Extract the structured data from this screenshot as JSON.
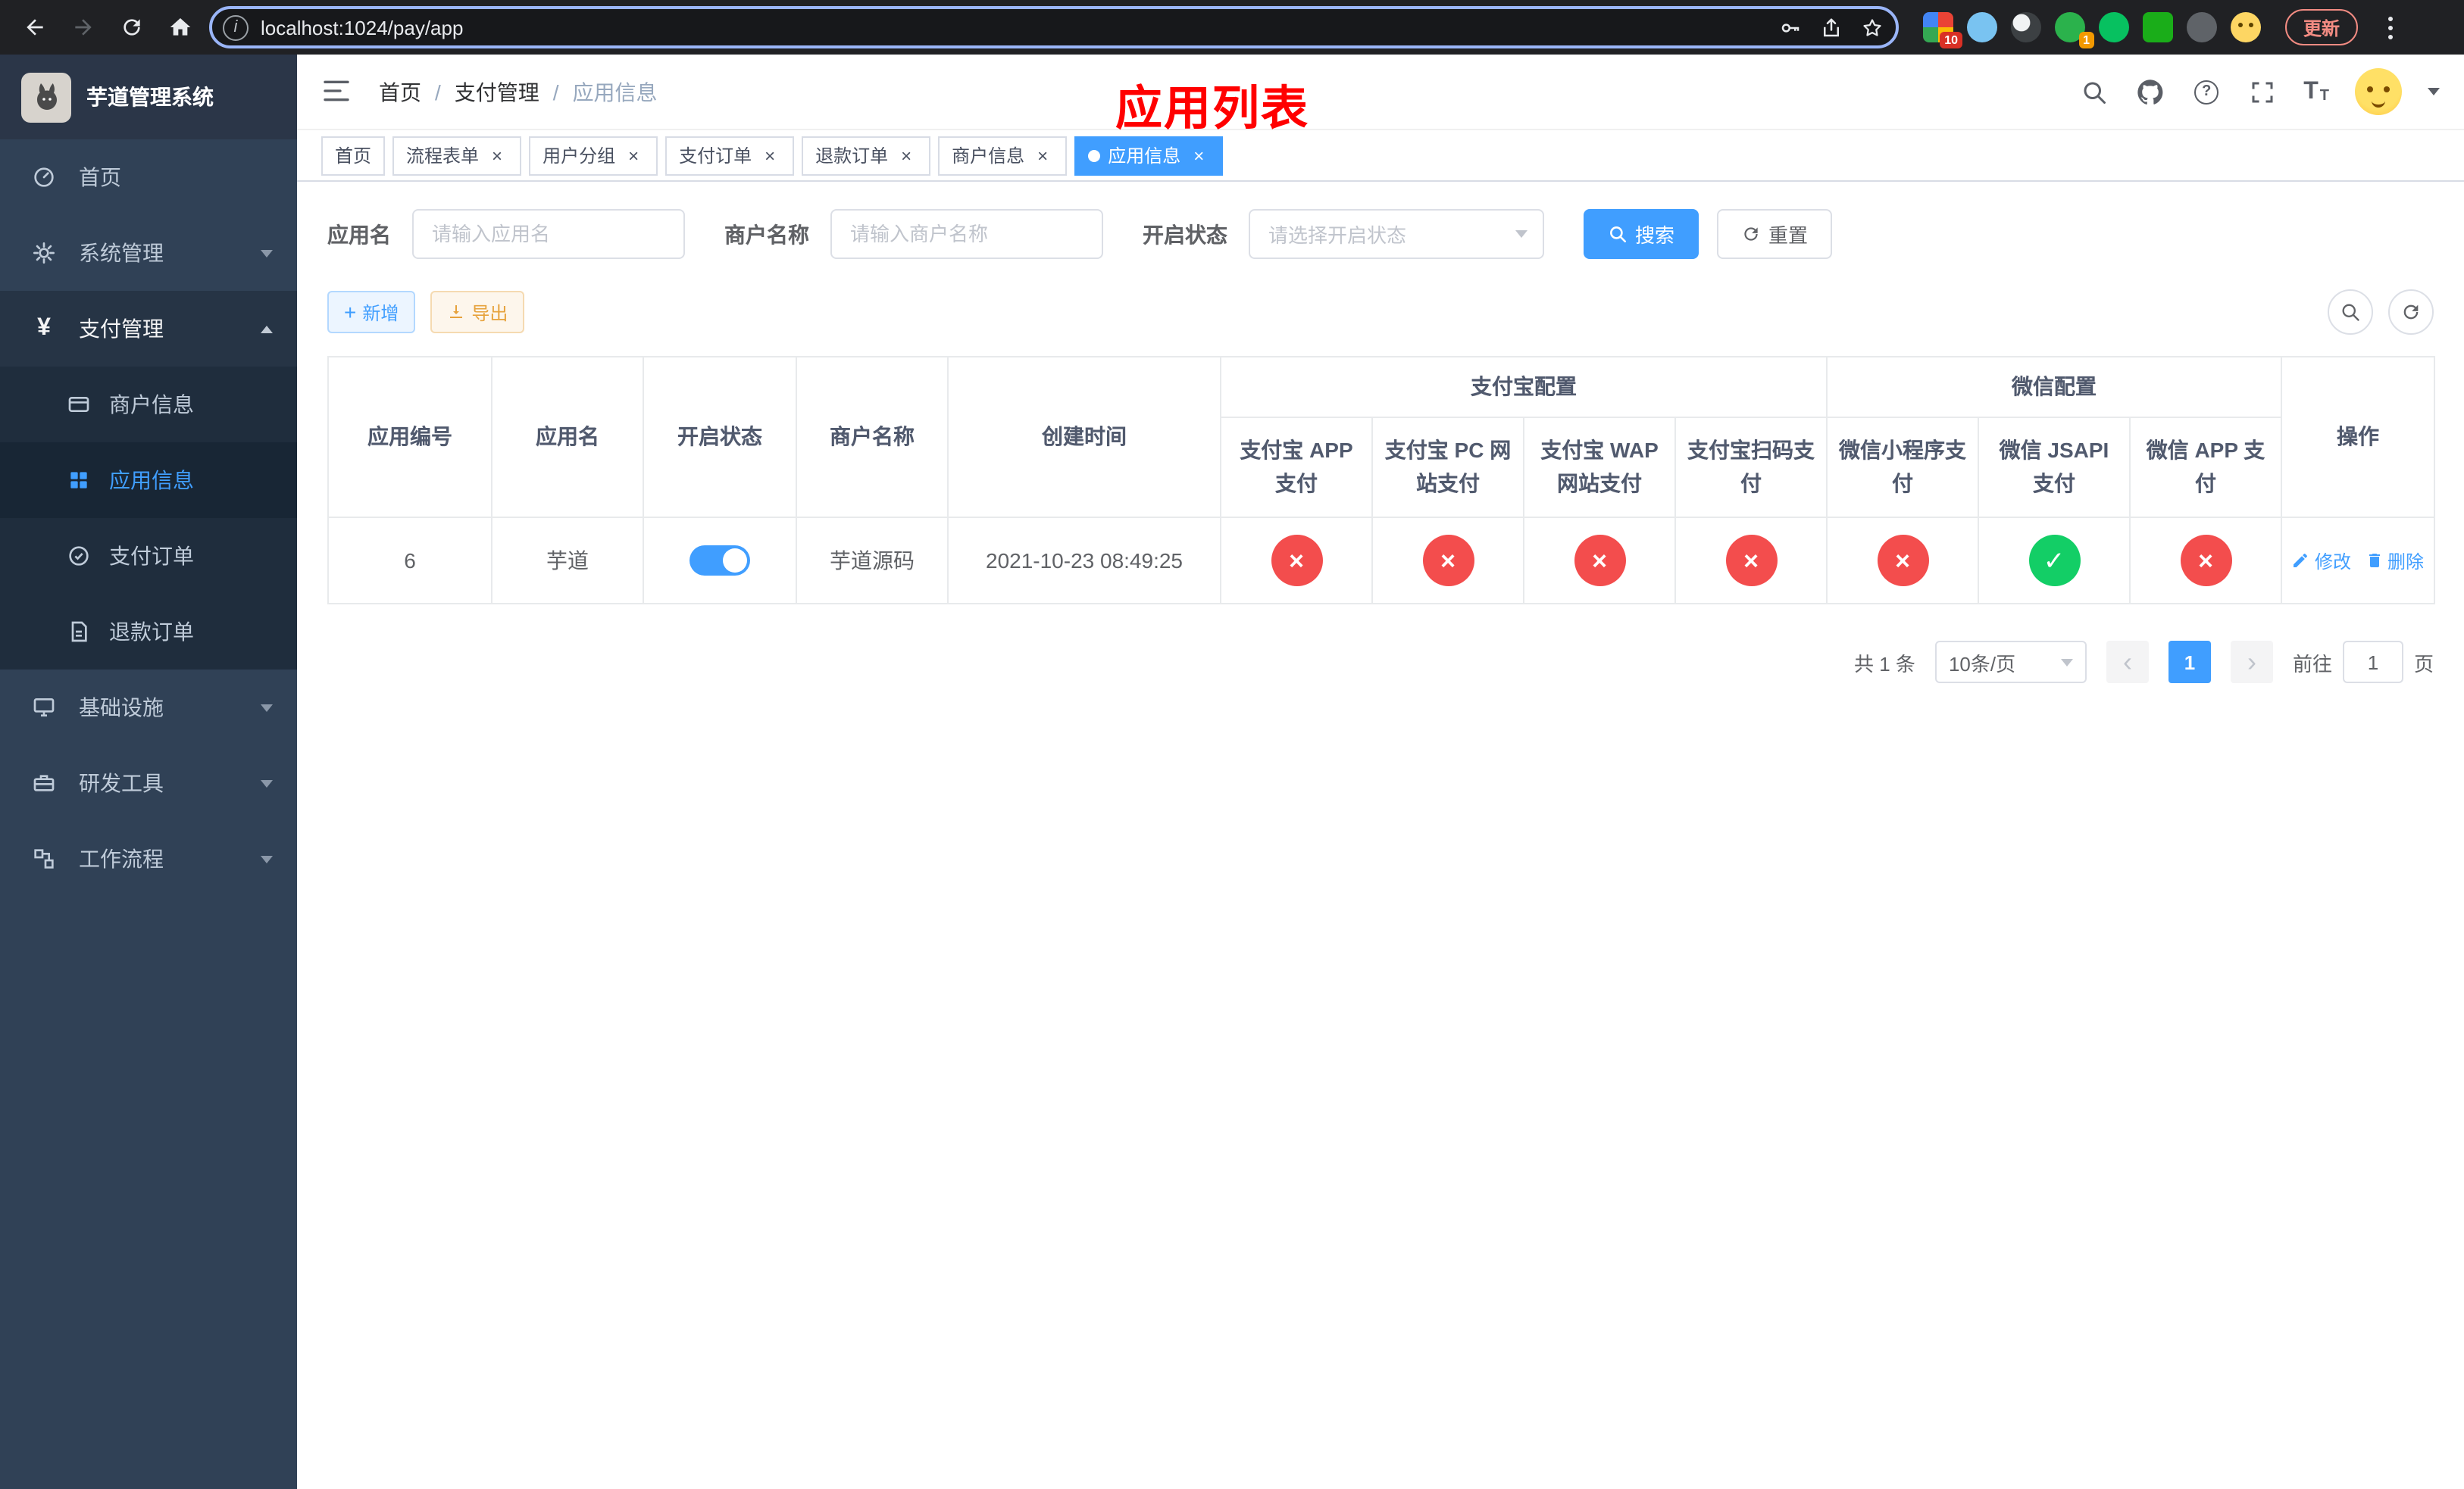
{
  "browser": {
    "url": "localhost:1024/pay/app",
    "update_label": "更新",
    "ext_badges": [
      "10",
      "1"
    ]
  },
  "header": {
    "breadcrumb": [
      "首页",
      "支付管理",
      "应用信息"
    ],
    "breadcrumb_separator": "/",
    "overlay_title": "应用列表"
  },
  "sidebar": {
    "title": "芋道管理系统",
    "items": [
      {
        "label": "首页"
      },
      {
        "label": "系统管理"
      },
      {
        "label": "支付管理"
      },
      {
        "label": "基础设施"
      },
      {
        "label": "研发工具"
      },
      {
        "label": "工作流程"
      }
    ],
    "payment_children": [
      {
        "label": "商户信息"
      },
      {
        "label": "应用信息"
      },
      {
        "label": "支付订单"
      },
      {
        "label": "退款订单"
      }
    ]
  },
  "tabs": [
    {
      "label": "首页"
    },
    {
      "label": "流程表单"
    },
    {
      "label": "用户分组"
    },
    {
      "label": "支付订单"
    },
    {
      "label": "退款订单"
    },
    {
      "label": "商户信息"
    },
    {
      "label": "应用信息"
    }
  ],
  "filters": {
    "app_name_label": "应用名",
    "app_name_placeholder": "请输入应用名",
    "merchant_label": "商户名称",
    "merchant_placeholder": "请输入商户名称",
    "status_label": "开启状态",
    "status_placeholder": "请选择开启状态",
    "search_label": "搜索",
    "reset_label": "重置"
  },
  "toolbar": {
    "add_label": "新增",
    "export_label": "导出"
  },
  "table": {
    "headers": {
      "id": "应用编号",
      "name": "应用名",
      "status": "开启状态",
      "merchant": "商户名称",
      "created": "创建时间",
      "alipay_group": "支付宝配置",
      "wechat_group": "微信配置",
      "alipay_app": "支付宝 APP 支付",
      "alipay_pc": "支付宝 PC 网站支付",
      "alipay_wap": "支付宝 WAP 网站支付",
      "alipay_qr": "支付宝扫码支付",
      "wx_mini": "微信小程序支付",
      "wx_jsapi": "微信 JSAPI 支付",
      "wx_app": "微信 APP 支付",
      "actions": "操作"
    },
    "ops": {
      "edit": "修改",
      "delete": "删除"
    },
    "rows": [
      {
        "id": "6",
        "name": "芋道",
        "enabled": true,
        "merchant": "芋道源码",
        "created": "2021-10-23 08:49:25",
        "alipay_app": false,
        "alipay_pc": false,
        "alipay_wap": false,
        "alipay_qr": false,
        "wx_mini": false,
        "wx_jsapi": true,
        "wx_app": false
      }
    ]
  },
  "pagination": {
    "total": "共 1 条",
    "page_size": "10条/页",
    "current_page": "1",
    "goto_prefix": "前往",
    "goto_suffix": "页",
    "goto_value": "1"
  },
  "icons": {
    "check": "✓",
    "cross": "×",
    "close": "×",
    "plus": "+",
    "prev": "‹",
    "next": "›",
    "question": "?",
    "info": "i",
    "yen": "¥",
    "font": "T"
  },
  "colors": {
    "primary": "#409eff",
    "success": "#13ce66",
    "danger": "#f34d4d",
    "warning": "#e6a23c",
    "annotation": "#ff0000",
    "sidebar_bg": "#304156",
    "submenu_bg": "#1f2d3d"
  }
}
